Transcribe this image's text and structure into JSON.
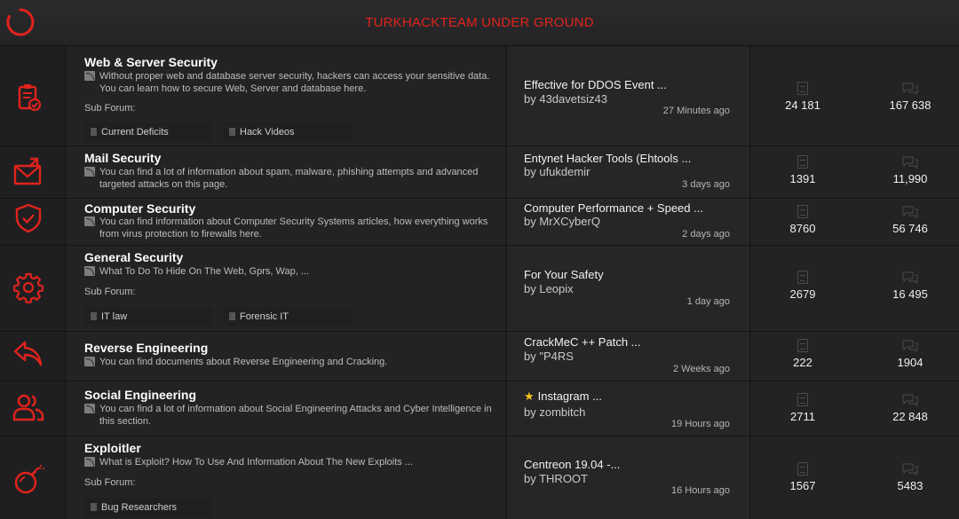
{
  "header": {
    "title": "TURKHACKTEAM UNDER GROUND"
  },
  "colors": {
    "accent": "#e0231c",
    "background": "#1c1c1e"
  },
  "forums": [
    {
      "icon": "clipboard-check-icon",
      "title": "Web & Server Security",
      "description": "Without proper web and database server security, hackers can access your sensitive data. You can learn how to secure Web, Server and database here.",
      "subforum_label": "Sub Forum:",
      "subforums": [
        "Current Deficits",
        "Hack Videos"
      ],
      "last_post": {
        "title": "Effective for DDOS Event ...",
        "by": "by 43davetsiz43",
        "time": "27 Minutes ago",
        "starred": false
      },
      "threads": "24 181",
      "posts": "167 638"
    },
    {
      "icon": "envelope-icon",
      "title": "Mail Security",
      "description": "You can find a lot of information about spam, malware, phishing attempts and advanced targeted attacks on this page.",
      "subforum_label": "",
      "subforums": [],
      "last_post": {
        "title": "Entynet Hacker Tools (Ehtools ...",
        "by": "by ufukdemir",
        "time": "3 days ago",
        "starred": false
      },
      "threads": "1391",
      "posts": "11,990"
    },
    {
      "icon": "shield-check-icon",
      "title": "Computer Security",
      "description": "You can find information about Computer Security Systems articles, how everything works from virus protection to firewalls here.",
      "subforum_label": "",
      "subforums": [],
      "last_post": {
        "title": "Computer Performance + Speed ...",
        "by": "by MrXCyberQ",
        "time": "2 days ago",
        "starred": false
      },
      "threads": "8760",
      "posts": "56 746"
    },
    {
      "icon": "gear-icon",
      "title": "General Security",
      "description": "What To Do To Hide On The Web, Gprs, Wap, ...",
      "subforum_label": "Sub Forum:",
      "subforums": [
        "IT law",
        "Forensic IT"
      ],
      "last_post": {
        "title": "For Your Safety",
        "by": "by Leopix",
        "time": "1 day ago",
        "starred": false
      },
      "threads": "2679",
      "posts": "16 495"
    },
    {
      "icon": "reply-arrow-icon",
      "title": "Reverse Engineering",
      "description": "You can find documents about Reverse Engineering and Cracking.",
      "subforum_label": "",
      "subforums": [],
      "last_post": {
        "title": "CrackMeC ++ Patch ...",
        "by": "by \"P4RS",
        "time": "2 Weeks ago",
        "starred": false
      },
      "threads": "222",
      "posts": "1904"
    },
    {
      "icon": "users-icon",
      "title": "Social Engineering",
      "description": "You can find a lot of information about Social Engineering Attacks and Cyber Intelligence in this section.",
      "subforum_label": "",
      "subforums": [],
      "last_post": {
        "title": "Instagram ...",
        "by": "by zombitch",
        "time": "19 Hours ago",
        "starred": true
      },
      "threads": "2711",
      "posts": "22 848"
    },
    {
      "icon": "bomb-icon",
      "title": "Exploitler",
      "description": "What is Exploit? How To Use And Information About The New Exploits ...",
      "subforum_label": "Sub Forum:",
      "subforums": [
        "Bug Researchers"
      ],
      "last_post": {
        "title": "Centreon 19.04 -...",
        "by": "by THROOT",
        "time": "16 Hours ago",
        "starred": false
      },
      "threads": "1567",
      "posts": "5483"
    }
  ]
}
